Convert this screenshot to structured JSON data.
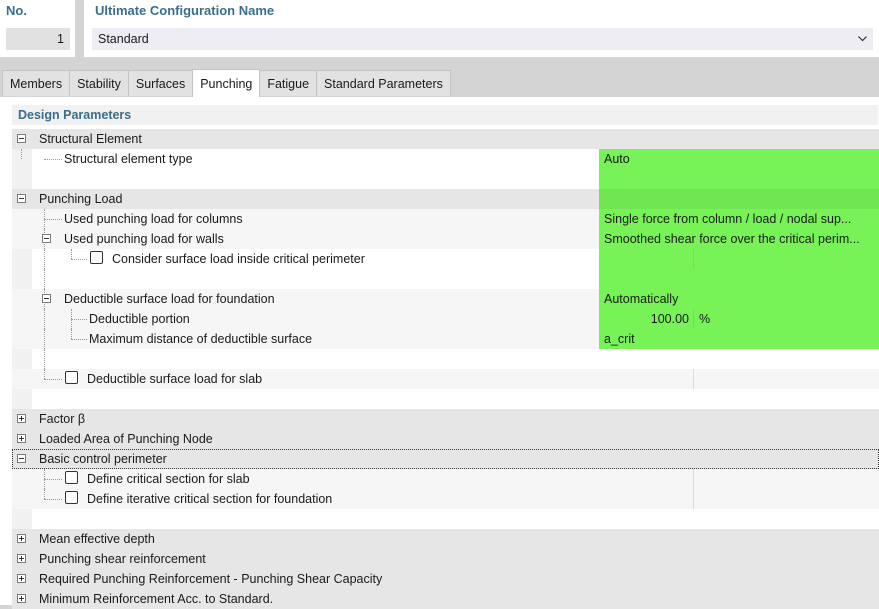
{
  "header": {
    "no_label": "No.",
    "no_value": "1",
    "name_label": "Ultimate Configuration Name",
    "name_value": "Standard"
  },
  "tabs": [
    {
      "label": "Members",
      "active": false
    },
    {
      "label": "Stability",
      "active": false
    },
    {
      "label": "Surfaces",
      "active": false
    },
    {
      "label": "Punching",
      "active": true
    },
    {
      "label": "Fatigue",
      "active": false
    },
    {
      "label": "Standard Parameters",
      "active": false
    }
  ],
  "section_title": "Design Parameters",
  "tree": {
    "structural_element": {
      "label": "Structural Element",
      "type_label": "Structural element type",
      "type_value": "Auto"
    },
    "punching_load": {
      "label": "Punching Load",
      "columns_label": "Used punching load for columns",
      "columns_value": "Single force from column / load / nodal sup...",
      "walls_label": "Used punching load for walls",
      "walls_value": "Smoothed shear force over the critical perim...",
      "surface_load_label": "Consider surface load inside critical perimeter",
      "surface_load_checked": false,
      "foundation_label": "Deductible surface load for foundation",
      "foundation_value": "Automatically",
      "portion_label": "Deductible portion",
      "portion_value": "100.00",
      "portion_unit": "%",
      "max_distance_label": "Maximum distance of deductible surface",
      "max_distance_value": "a_crit",
      "slab_label": "Deductible surface load for slab",
      "slab_checked": false
    },
    "factor_beta": {
      "label": "Factor β"
    },
    "loaded_area": {
      "label": "Loaded Area of Punching Node"
    },
    "basic_control": {
      "label": "Basic control perimeter",
      "slab_label": "Define critical section for slab",
      "foundation_label": "Define iterative critical section for foundation"
    },
    "mean_depth": {
      "label": "Mean effective depth"
    },
    "shear_reinf": {
      "label": "Punching shear reinforcement"
    },
    "required_reinf": {
      "label": "Required Punching Reinforcement - Punching Shear Capacity"
    },
    "min_reinf": {
      "label": "Minimum Reinforcement Acc. to Standard."
    }
  },
  "colors": {
    "accent": "#3a6d8f",
    "valid_value_bg": "#77f357"
  }
}
